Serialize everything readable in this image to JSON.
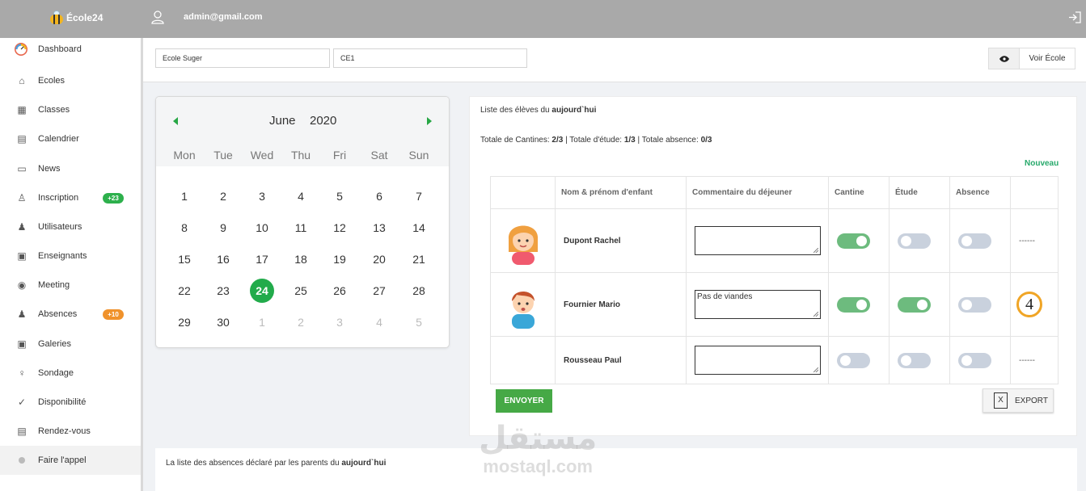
{
  "header": {
    "app_name": "École24",
    "user_email": "admin@gmail.com",
    "logout_icon": "logout-icon",
    "user_icon": "user-icon"
  },
  "sidebar": {
    "items": [
      {
        "label": "Dashboard",
        "icon": "dashboard-icon"
      },
      {
        "label": "Ecoles",
        "icon": "home-icon"
      },
      {
        "label": "Classes",
        "icon": "grid-icon"
      },
      {
        "label": "Calendrier",
        "icon": "calendar-icon"
      },
      {
        "label": "News",
        "icon": "news-icon"
      },
      {
        "label": "Inscription",
        "icon": "user-add-icon",
        "badge": "+23",
        "badge_color": "#2db04c"
      },
      {
        "label": "Utilisateurs",
        "icon": "users-icon"
      },
      {
        "label": "Enseignants",
        "icon": "teacher-icon"
      },
      {
        "label": "Meeting",
        "icon": "meeting-icon"
      },
      {
        "label": "Absences",
        "icon": "user-x-icon",
        "badge": "+10",
        "badge_color": "#f0922b"
      },
      {
        "label": "Galeries",
        "icon": "gallery-icon"
      },
      {
        "label": "Sondage",
        "icon": "bulb-icon"
      },
      {
        "label": "Disponibilité",
        "icon": "check-circle-icon"
      },
      {
        "label": "Rendez-vous",
        "icon": "calendar-check-icon"
      },
      {
        "label": "Faire l'appel",
        "icon": "dot-icon",
        "active": true
      }
    ]
  },
  "filters": {
    "school": "Ecole Suger",
    "class": "CE1",
    "voir_label": "Voir École"
  },
  "calendar": {
    "month": "June",
    "year": "2020",
    "weekdays": [
      "Mon",
      "Tue",
      "Wed",
      "Thu",
      "Fri",
      "Sat",
      "Sun"
    ],
    "weeks": [
      [
        "1",
        "2",
        "3",
        "4",
        "5",
        "6",
        "7"
      ],
      [
        "8",
        "9",
        "10",
        "11",
        "12",
        "13",
        "14"
      ],
      [
        "15",
        "16",
        "17",
        "18",
        "19",
        "20",
        "21"
      ],
      [
        "22",
        "23",
        "24",
        "25",
        "26",
        "27",
        "28"
      ],
      [
        "29",
        "30",
        "1",
        "2",
        "3",
        "4",
        "5"
      ]
    ],
    "selected_day": "24"
  },
  "main": {
    "title_prefix": "Liste des élèves du",
    "title_bold": "aujourd`hui",
    "totals": {
      "cantines_label": "Totale de Cantines:",
      "cantines_value": "2/3",
      "etude_label": "Totale d'étude:",
      "etude_value": "1/3",
      "absence_label": "Totale absence:",
      "absence_value": "0/3"
    },
    "new_label": "Nouveau",
    "columns": [
      "",
      "Nom & prénom d'enfant",
      "Commentaire du déjeuner",
      "Cantine",
      "Étude",
      "Absence",
      ""
    ],
    "rows": [
      {
        "name": "Dupont Rachel",
        "avatar": "girl-avatar-icon",
        "comment": "",
        "cantine": true,
        "etude": false,
        "absence": false,
        "extra": "------"
      },
      {
        "name": "Fournier Mario",
        "avatar": "boy-avatar-icon",
        "comment": "Pas de viandes",
        "cantine": true,
        "etude": true,
        "absence": false,
        "extra": "4"
      },
      {
        "name": "Rousseau Paul",
        "avatar": "",
        "comment": "",
        "cantine": false,
        "etude": false,
        "absence": false,
        "extra": "------"
      }
    ],
    "send_label": "ENVOYER",
    "export_label": "EXPORT"
  },
  "absences_panel": {
    "text_prefix": "La liste des absences déclaré par les parents du",
    "text_bold": "aujourd`hui"
  },
  "watermark": {
    "arabic": "مستقل",
    "latin": "mostaql.com"
  }
}
